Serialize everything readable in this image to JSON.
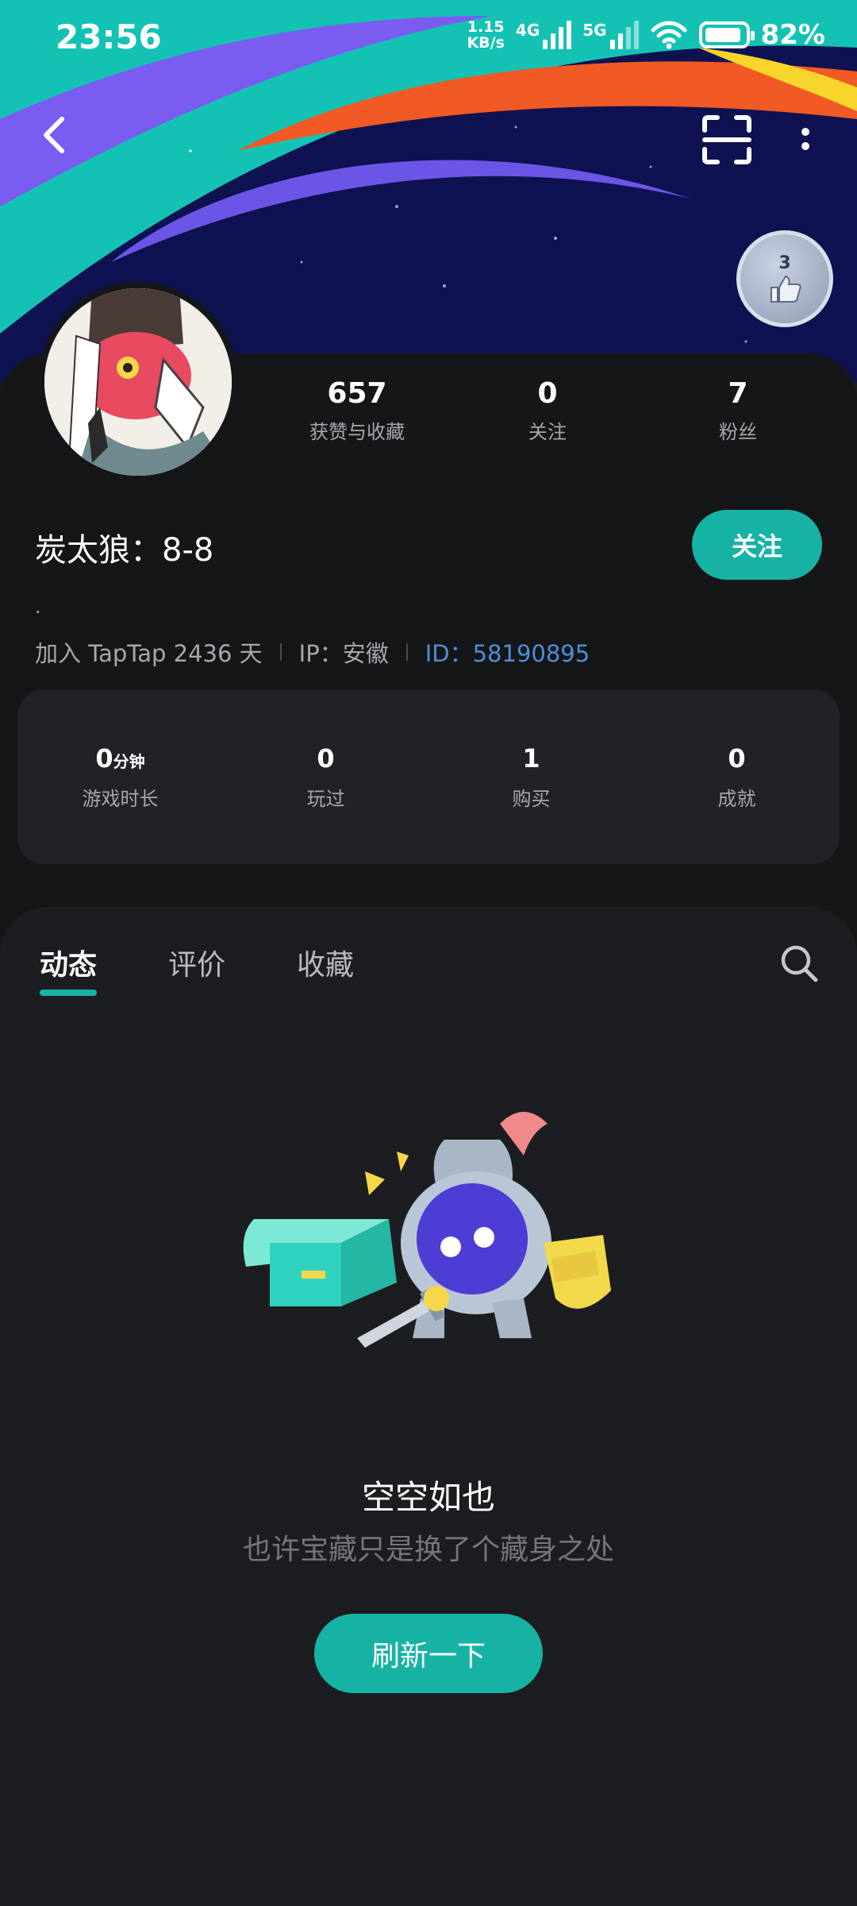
{
  "status_bar": {
    "time": "23:56",
    "speed_value": "1.15",
    "speed_unit": "KB/s",
    "net1": "4G",
    "net2": "5G",
    "battery": "82%"
  },
  "level_badge": {
    "number": "3"
  },
  "profile": {
    "stats": [
      {
        "value": "657",
        "label": "获赞与收藏"
      },
      {
        "value": "0",
        "label": "关注"
      },
      {
        "value": "7",
        "label": "粉丝"
      }
    ],
    "username": "炭太狼：8-8",
    "follow_label": "关注",
    "bio": ".",
    "join_text": "加入 TapTap 2436 天",
    "ip_text": "IP：安徽",
    "id_text": "ID：58190895"
  },
  "game_stats": [
    {
      "value": "0",
      "unit": "分钟",
      "label": "游戏时长"
    },
    {
      "value": "0",
      "unit": "",
      "label": "玩过"
    },
    {
      "value": "1",
      "unit": "",
      "label": "购买"
    },
    {
      "value": "0",
      "unit": "",
      "label": "成就"
    }
  ],
  "tabs": [
    "动态",
    "评价",
    "收藏"
  ],
  "empty_state": {
    "title": "空空如也",
    "subtitle": "也许宝藏只是换了个藏身之处",
    "button": "刷新一下"
  },
  "colors": {
    "accent": "#16b3a4",
    "id_link": "#4f8ed8",
    "background": "#151618"
  }
}
